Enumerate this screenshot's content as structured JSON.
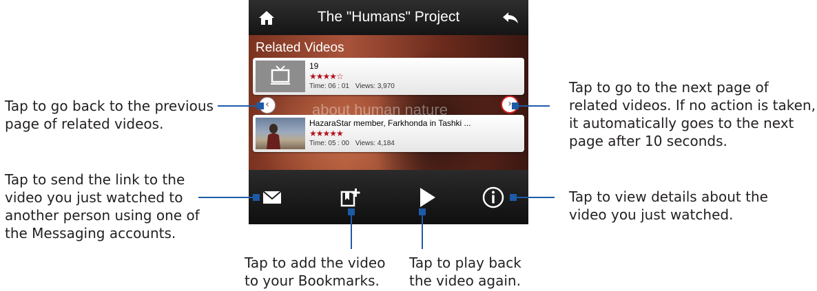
{
  "screen": {
    "title": "The \"Humans\" Project",
    "icons": {
      "home": "home-icon",
      "back": "back-arrow-icon"
    },
    "related_heading": "Related Videos",
    "background_text": "about human nature",
    "videos": [
      {
        "title": "19",
        "rating": "★★★★☆",
        "time": "Time:  06 : 01",
        "views": "Views: 3,970",
        "thumb": "tv-icon"
      },
      {
        "title": "HazaraStar member, Farkhonda in Tashki ...",
        "rating": "★★★★★",
        "time": "Time:  05 : 00",
        "views": "Views: 4,184",
        "thumb": "video-thumbnail"
      }
    ],
    "nav": {
      "prev": "‹",
      "next": "›"
    },
    "toolbar": {
      "items": [
        "mail-icon",
        "bookmark-add-icon",
        "play-icon",
        "info-icon"
      ]
    }
  },
  "callouts": {
    "prev": "Tap to go back to the previous\npage of related videos.",
    "next": "Tap to go to the next page of\nrelated videos. If no action is taken,\nit automatically goes to the next\npage after 10 seconds.",
    "send": "Tap to send the link to the\nvideo you just watched to\nanother person using one of\nthe Messaging accounts.",
    "details": "Tap to view details about the\nvideo you just watched.",
    "bookmark": "Tap to add the video\nto your Bookmarks.",
    "play": "Tap to play back\nthe video again."
  },
  "colors": {
    "callout_line": "#1d5aa8",
    "next_ring": "#d41e1e",
    "star": "#b3121a"
  }
}
